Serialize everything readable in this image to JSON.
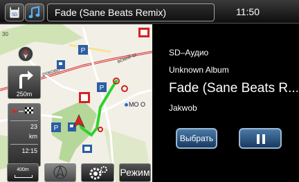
{
  "header": {
    "source_icons": [
      "sd-card-icon",
      "music-note-icon"
    ],
    "now_playing_title": "Fade (Sane Beats Remix)",
    "clock": "11:50"
  },
  "map": {
    "street_labels": [
      "30",
      "вский ш",
      "роково",
      "МО О"
    ],
    "poi_icons": [
      "parking-icon",
      "lukoil-icon",
      "fuel-icon",
      "bus-stop-icon"
    ],
    "turn_distance": "250m",
    "route_info": {
      "remaining_distance_value": "23",
      "remaining_distance_unit": "km",
      "arrival_time": "12:15"
    },
    "scale_label": "400m",
    "mode_label": "Режим"
  },
  "player": {
    "source": "SD–Аудио",
    "album": "Unknown Album",
    "track": "Fade (Sane Beats R...",
    "artist": "Jakwob",
    "select_label": "Выбрать"
  },
  "colors": {
    "map_background": "#f2efe6",
    "park_green": "#cfe3b4",
    "route_green": "#2fd12f",
    "road_red": "#cc2222",
    "button_blue": "#2d5a8c"
  }
}
